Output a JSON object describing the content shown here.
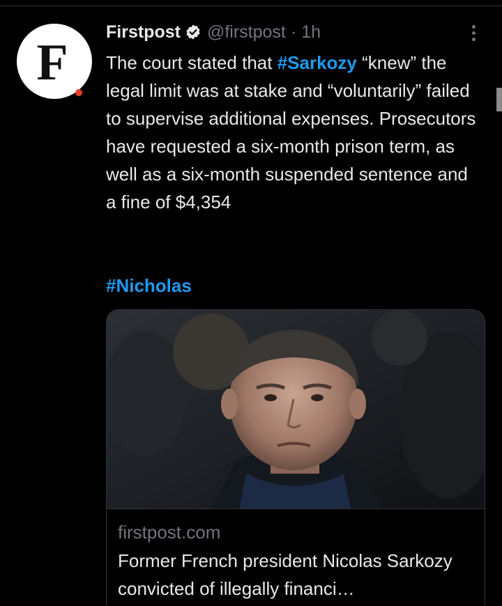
{
  "tweet": {
    "author": {
      "avatar_letter": "F",
      "display_name": "Firstpost",
      "handle": "@firstpost",
      "separator": "·",
      "time": "1h"
    },
    "text_before": "The court stated that ",
    "hashtag_sarkozy": "#Sarkozy",
    "text_after": " “knew” the legal limit was at stake and “voluntarily” failed to supervise additional expenses. Prosecutors have requested a six-month prison term, as well as a six-month suspended sentence and a fine of $4,354",
    "hashtag_nicholas": "#Nicholas"
  },
  "card": {
    "domain": "firstpost.com",
    "title": "Former French president Nicolas Sarkozy convicted of illegally financi…"
  },
  "colors": {
    "background": "#000000",
    "text": "#e7e9ea",
    "muted": "#71767b",
    "link": "#1d9bf0",
    "brand_dot": "#e8402c"
  },
  "icons": {
    "verified": "verified-badge-icon",
    "more": "more-options-icon"
  }
}
